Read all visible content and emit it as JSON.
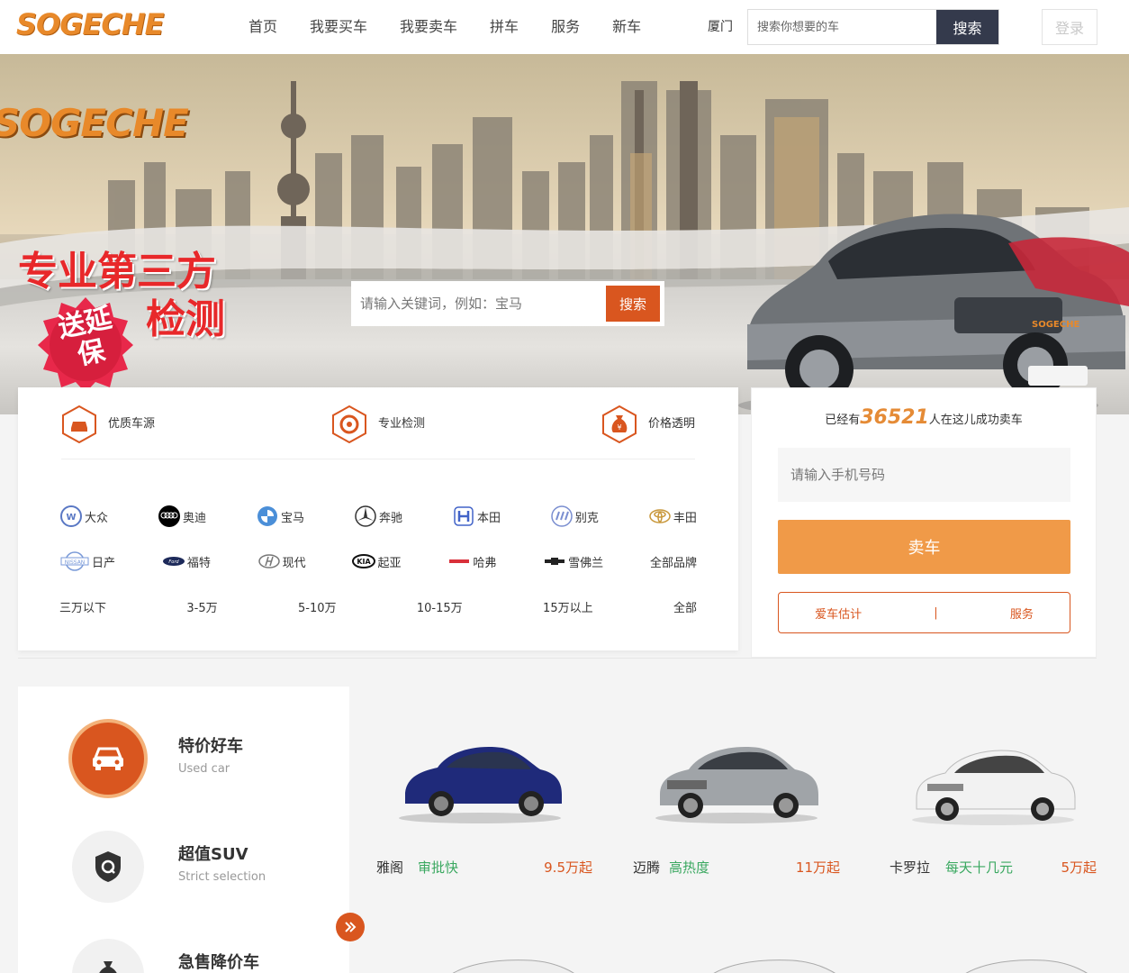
{
  "header": {
    "logo": "SOGECHE",
    "nav": [
      "首页",
      "我要买车",
      "我要卖车",
      "拼车",
      "服务",
      "新车"
    ],
    "city": "厦门",
    "search_placeholder": "搜索你想要的车",
    "search_button": "搜索",
    "login_button": "登录"
  },
  "banner": {
    "logo": "SOGECHE",
    "slogan_line1": "专业第三方",
    "slogan_line2": "检测",
    "badge": "送延保",
    "car_plate": "SOGECHE",
    "search_placeholder": "请输入关键词，例如：宝马",
    "search_button": "搜索"
  },
  "features": [
    {
      "icon": "car-icon",
      "label": "优质车源"
    },
    {
      "icon": "inspection-icon",
      "label": "专业检测"
    },
    {
      "icon": "money-bag-icon",
      "label": "价格透明"
    }
  ],
  "brands_row1": [
    {
      "icon": "volkswagen-logo-icon",
      "label": "大众"
    },
    {
      "icon": "audi-logo-icon",
      "label": "奥迪"
    },
    {
      "icon": "bmw-logo-icon",
      "label": "宝马"
    },
    {
      "icon": "mercedes-logo-icon",
      "label": "奔驰"
    },
    {
      "icon": "honda-logo-icon",
      "label": "本田"
    },
    {
      "icon": "buick-logo-icon",
      "label": "别克"
    },
    {
      "icon": "toyota-logo-icon",
      "label": "丰田"
    }
  ],
  "brands_row2": [
    {
      "icon": "nissan-logo-icon",
      "label": "日产"
    },
    {
      "icon": "ford-logo-icon",
      "label": "福特"
    },
    {
      "icon": "hyundai-logo-icon",
      "label": "现代"
    },
    {
      "icon": "kia-logo-icon",
      "label": "起亚"
    },
    {
      "icon": "haval-logo-icon",
      "label": "哈弗"
    },
    {
      "icon": "chevrolet-logo-icon",
      "label": "雪佛兰"
    },
    {
      "icon": "",
      "label": "全部品牌"
    }
  ],
  "price_ranges": [
    "三万以下",
    "3-5万",
    "5-10万",
    "10-15万",
    "15万以上",
    "全部"
  ],
  "sell": {
    "count_prefix": "已经有",
    "count": "36521",
    "count_suffix": "人在这儿成功卖车",
    "phone_placeholder": "请输入手机号码",
    "sell_button": "卖车",
    "link1": "爱车估计",
    "separator": "|",
    "link2": "服务"
  },
  "categories": [
    {
      "title": "特价好车",
      "subtitle": "Used car",
      "icon": "car-front-icon",
      "active": true
    },
    {
      "title": "超值SUV",
      "subtitle": "Strict selection",
      "icon": "shield-q-icon",
      "active": false
    },
    {
      "title": "急售降价车",
      "subtitle": "",
      "icon": "money-bag-icon",
      "active": false
    }
  ],
  "cars": [
    {
      "name": "雅阁",
      "tag": "审批快",
      "price": "9.5万起",
      "color": "#1f2a7a"
    },
    {
      "name": "迈腾",
      "tag": "高热度",
      "price": "11万起",
      "color": "#a0a4a8"
    },
    {
      "name": "卡罗拉",
      "tag": "每天十几元",
      "price": "5万起",
      "color": "#f2f2f2"
    }
  ],
  "colors": {
    "accent": "#d9561f",
    "orange": "#f09a48",
    "green": "#3aa860",
    "dark": "#343a4c"
  }
}
